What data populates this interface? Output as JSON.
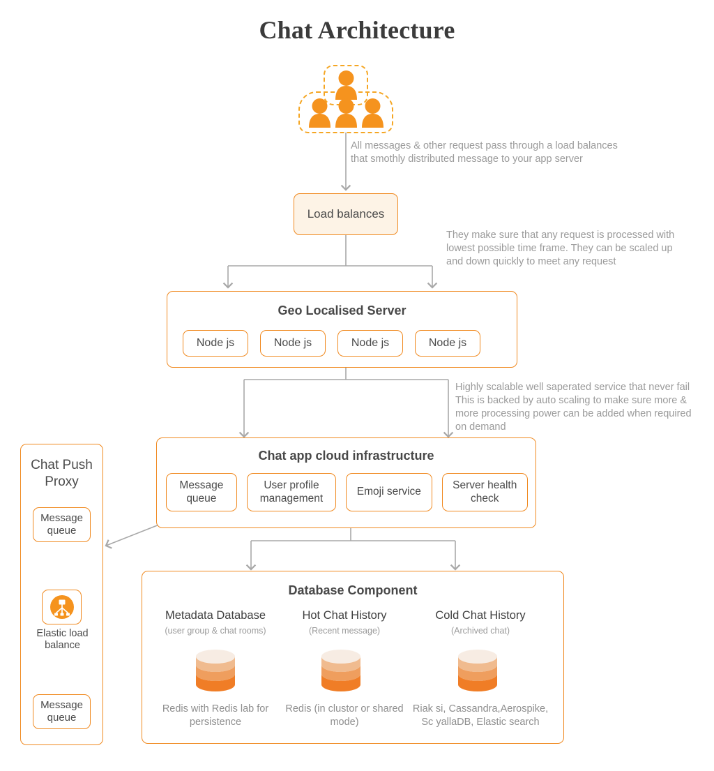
{
  "title": "Chat Architecture",
  "users": {
    "icon": "users-group-icon",
    "count": 4
  },
  "notes": {
    "note1": "All messages & other request  pass through a load balances that smothly distributed message to your app server",
    "note2": "They make sure that any request is processed with lowest possible time frame. They can be scaled up and  down quickly to meet any request",
    "note3": "Highly scalable well saperated service that never fail This is backed by auto scaling to make sure more & more processing power can be added when required on demand"
  },
  "load_balancer": {
    "label": "Load balances"
  },
  "geo_server": {
    "title": "Geo Localised Server",
    "nodes": [
      {
        "label": "Node js"
      },
      {
        "label": "Node js"
      },
      {
        "label": "Node js"
      },
      {
        "label": "Node js"
      }
    ]
  },
  "cloud_infra": {
    "title": "Chat app cloud infrastructure",
    "services": [
      {
        "label": "Message queue"
      },
      {
        "label": "User profile management"
      },
      {
        "label": "Emoji service"
      },
      {
        "label": "Server health check"
      }
    ]
  },
  "push_proxy": {
    "title": "Chat Push Proxy",
    "top_queue": "Message queue",
    "elastic": {
      "icon": "elastic-load-balancer-icon",
      "label": "Elastic load balance"
    },
    "bottom_queue": "Message queue"
  },
  "database": {
    "title": "Database Component",
    "columns": [
      {
        "title": "Metadata Database",
        "subtitle": "(user group & chat rooms)",
        "icon": "database-cylinder-icon",
        "caption": "Redis with Redis lab for persistence"
      },
      {
        "title": "Hot Chat History",
        "subtitle": "(Recent message)",
        "icon": "database-cylinder-icon",
        "caption": "Redis (in clustor or shared mode)"
      },
      {
        "title": "Cold Chat History",
        "subtitle": "(Archived chat)",
        "icon": "database-cylinder-icon",
        "caption": "Riak si, Cassandra,Aerospike, Sc yallaDB, Elastic search"
      }
    ]
  },
  "colors": {
    "accent": "#f0891f",
    "accent_light": "#f5a623",
    "box_fill": "#fdf3e6",
    "connector": "#a8a8a8",
    "note_text": "#9a9a9a",
    "title_text": "#3b3b3b"
  }
}
